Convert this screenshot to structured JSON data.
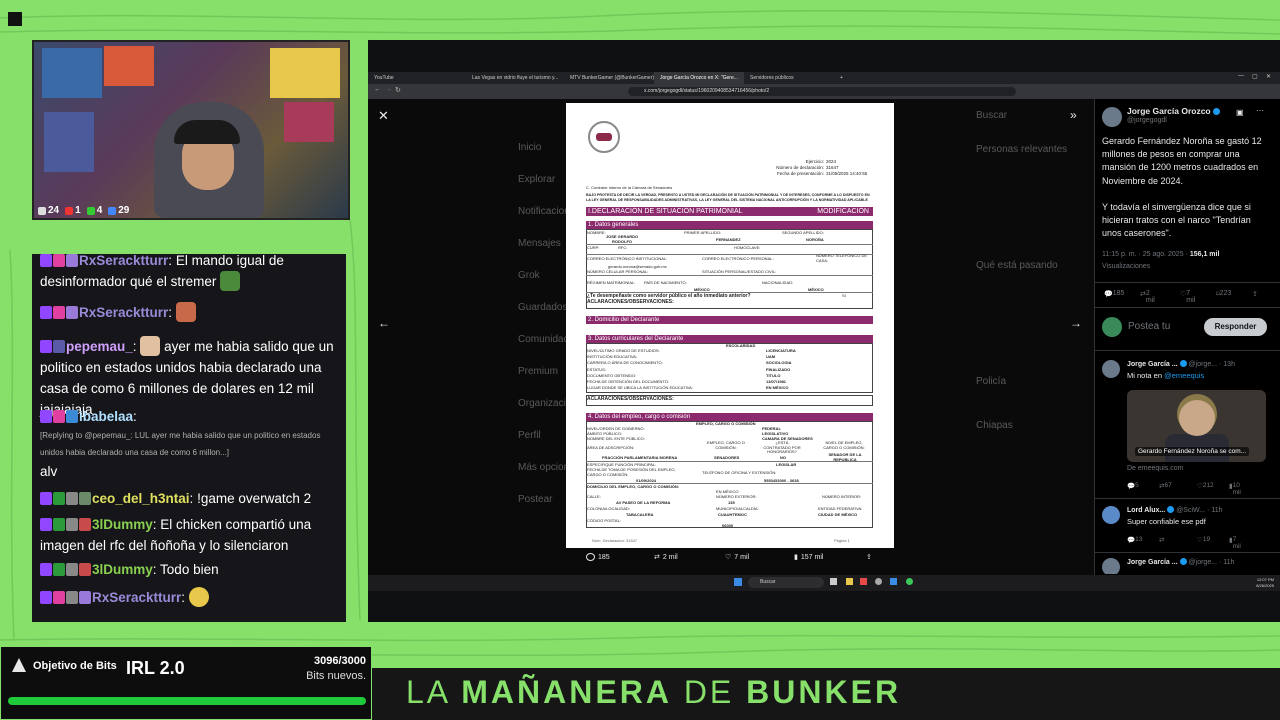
{
  "stream_title": {
    "prefix": "LA ",
    "word1": "MAÑANERA",
    "mid": " DE ",
    "word2": "BUNKER"
  },
  "webcam": {
    "stats": [
      "24",
      "1",
      "4",
      "29"
    ]
  },
  "chat": {
    "messages": [
      {
        "user": "RxSeracktturr",
        "text": "El mando igual de desinformador qué el stremer"
      },
      {
        "user": "RxSeracktturr",
        "text": ""
      },
      {
        "user": "pepemau_",
        "text": "ayer me habia salido que un politico en estados unidos habia declarado una casa de como 6 millones de dolares en 12 mil jajajajaja"
      },
      {
        "user": "ibabelaa",
        "reply": "[Replying to @pepemau_: LUL ayer me habia salido que un politico en estados unidos habia declarado una casa de como 6 millon...]",
        "text": "alv"
      },
      {
        "user": "ceo_del_h3ntai",
        "text": "!game overwatch 2"
      },
      {
        "user": "3lDummy",
        "text": "El chicken compartió una imagen del rfc del ñoñoña y lo silenciaron"
      },
      {
        "user": "3lDummy",
        "text": "Todo bien"
      },
      {
        "user": "RxSeracktturr",
        "text": ""
      }
    ]
  },
  "bits_goal": {
    "label": "Objetivo de Bits",
    "title": "IRL 2.0",
    "count": "3096/3000",
    "sub": "Bits nuevos.",
    "progress": 1.0
  },
  "browser": {
    "tabs": [
      "YouTube",
      "Las Vegas en vidrio fluye el turismo y...",
      "MTV BunkerGamer (@BunkerGamer)",
      "Jorge García Orozco en X: \"Gere...",
      "Servidores públicos"
    ],
    "active_tab": 3,
    "url": "x.com/jorgegogdl/status/1960209408534716456/photo/2",
    "taskbar_search": "Buscar",
    "clock_time": "12:07 PM",
    "clock_date": "8/26/2025"
  },
  "background_nav": [
    "Inicio",
    "Explorar",
    "Notificaciones",
    "Mensajes",
    "Grok",
    "Guardados",
    "Comunidades",
    "Premium",
    "Organizaciones",
    "Perfil",
    "Más opciones",
    "Postear"
  ],
  "background_right": [
    "Buscar",
    "Personas relevantes",
    "Qué está pasando",
    "Policía",
    "Chiapas"
  ],
  "document": {
    "header_lines": [
      "Ejercicio:",
      "Número de declaración:",
      "Fecha de presentación:"
    ],
    "header_values": [
      "2024",
      "31647",
      "31/05/2025 14:40:55"
    ],
    "addressee": "C. Contralor Interno de la Cámara de Senadores",
    "intro": "BAJO PROTESTA DE DECIR LA VERDAD, PRESENTO A USTED MI DECLARACIÓN DE SITUACIÓN PATRIMONIAL Y DE INTERESES, CONFORME A LO DISPUESTO EN LA LEY GENERAL DE RESPONSABILIDADES ADMINISTRATIVAS, LA LEY GENERAL DEL SISTEMA NACIONAL ANTICORRUPCIÓN Y LA NORMATIVIDAD APLICABLE",
    "title": "I.DECLARACIÓN DE SITUACIÓN PATRIMONIAL",
    "mode": "MODIFICACIÓN",
    "sections": [
      "1. Datos generales",
      "2. Domicilio del Declarante",
      "3. Datos curriculares del Declarante",
      "4. Datos del empleo, cargo o comisión"
    ],
    "s1_labels": [
      "NOMBRE:",
      "PRIMER APELLIDO:",
      "SEGUNDO APELLIDO:"
    ],
    "s1_values": [
      "JOSE GERARDO RODOLFO",
      "FERNANDEZ",
      "NOROÑA"
    ],
    "s1_more": [
      "CURP:",
      "RFC:",
      "HOMOCLAVE:",
      "CORREO ELECTRÓNICO INSTITUCIONAL:",
      "CORREO ELECTRÓNICO PERSONAL:",
      "NÚMERO TELEFÓNICO DE CASA:"
    ],
    "email": "gerardo.norona@senado.gob.mx",
    "s1_more2": [
      "NÚMERO CELULAR PERSONAL:",
      "SITUACIÓN PERSONAL/ESTADO CIVIL:",
      "RÉGIMEN MATRIMONIAL:",
      "PAÍS DE NACIMIENTO:",
      "NACIONALIDAD:"
    ],
    "country": "MÉXICO",
    "question": "¿Te desempeñaste como servidor público el año inmediato anterior?",
    "answer": "SI",
    "obs": "ACLARACIONES/OBSERVACIONES:",
    "s3_rows": [
      [
        "NIVEL/ÚLTIMO GRADO DE ESTUDIOS:",
        "LICENCIATURA"
      ],
      [
        "INSTITUCIÓN EDUCATIVA:",
        "UAM"
      ],
      [
        "CARRERA O ÁREA DE CONOCIMIENTO:",
        "SOCIOLOGIA"
      ],
      [
        "ESTATUS:",
        "FINALIZADO"
      ],
      [
        "DOCUMENTO OBTENIDO:",
        "TITULO"
      ],
      [
        "FECHA DE OBTENCIÓN DEL DOCUMENTO:",
        "13/07/1981"
      ],
      [
        "LUGAR DONDE SE UBICA LA INSTITUCIÓN EDUCATIVA:",
        "EN MÉXICO"
      ]
    ],
    "s3_head": "ESCOLARIDAD",
    "s4_head": "EMPLEO, CARGO O COMISIÓN",
    "s4_rows": [
      [
        "NIVEL/ORDEN DE GOBIERNO:",
        "FEDERAL"
      ],
      [
        "ÁMBITO PÚBLICO:",
        "LEGISLATIVO"
      ],
      [
        "NOMBRE DEL ENTE PÚBLICO:",
        "CAMARA DE SENADORES"
      ]
    ],
    "s4_area": [
      "ÁREA DE ADSCRIPCIÓN:",
      "EMPLEO, CARGO O COMISIÓN:",
      "¿ESTÁ CONTRATADO POR HONORARIOS?",
      "NIVEL DE EMPLEO, CARGO O COMISIÓN:"
    ],
    "s4_area_vals": [
      "FRACCIÓN PARLAMENTARIA MORENA",
      "SENADORES",
      "NO",
      "SENADOR DE LA REPUBLICA"
    ],
    "s4_func": [
      "ESPECIFIQUE FUNCIÓN PRINCIPAL:",
      "LEGISLAR"
    ],
    "s4_date": [
      "FECHA DE TOMA DE POSESIÓN DEL EMPLEO, CARGO O COMISIÓN:",
      "TELÉFONO DE OFICINA Y EXTENSIÓN:",
      "01/09/2024",
      "5553453000 - 3638"
    ],
    "s4_addr": "DOMICILIO DEL EMPLEO, CARGO O COMISIÓN:",
    "s4_addr_rows": [
      [
        "EN MÉXICO"
      ],
      [
        "CALLE:",
        "NÚMERO EXTERIOR:",
        "NÚMERO INTERIOR:"
      ],
      [
        "AV PASEO DE LA REFORMA",
        "135"
      ],
      [
        "COLONIA/LOCALIDAD:",
        "MUNICIPIO/ALCALDÍA:",
        "ENTIDAD FEDERATIVA:"
      ],
      [
        "TABACALERA",
        "CUAUHTEMOC",
        "CIUDAD DE MÉXICO"
      ],
      [
        "CÓDIGO POSTAL:",
        "06030"
      ]
    ],
    "footer_left": "Núm. Declaración: 31647",
    "footer_right": "Página 1"
  },
  "tweet_actions": {
    "replies": "185",
    "retweets": "2 mil",
    "likes": "7 mil",
    "views": "157 mil"
  },
  "sidepane": {
    "author": "Jorge García Orozco",
    "handle": "@jorgegogdl",
    "text": "Gerardo Fernández Noroña se gastó 12 millones de pesos en comprar una mansión de 1200 metros cuadrados en Noviembre de 2024.\n\nY todavía el sinvergüenza dice que si hicieran tratos con el narco \"Tendrían unos caserones\".",
    "time": "11:15 p. m. · 25 ago. 2025 · ",
    "views": "156,1 mil",
    "views_label": "Visualizaciones",
    "stats": [
      "185",
      "2 mil",
      "7 mil",
      "223"
    ],
    "reply_placeholder": "Postea tu",
    "reply_button": "Responder",
    "replies": [
      {
        "name": "Jorge García ...",
        "handle": "@jorge...",
        "time": "· 13h",
        "text": "Mi nota en ",
        "link": "@emeequis",
        "card_caption": "Gerardo Fernández Noroña se com...",
        "card_source": "De emeequis.com",
        "stats": [
          "5",
          "67",
          "212",
          "10 mil"
        ]
      },
      {
        "name": "Lord Alux...",
        "handle": "@SciW...",
        "time": "· 11h",
        "text": "Super confiable ese pdf",
        "stats": [
          "13",
          "",
          "19",
          "7 mil"
        ]
      },
      {
        "name": "Jorge García ...",
        "handle": "@jorge...",
        "time": "· 11h",
        "text": ""
      }
    ]
  }
}
